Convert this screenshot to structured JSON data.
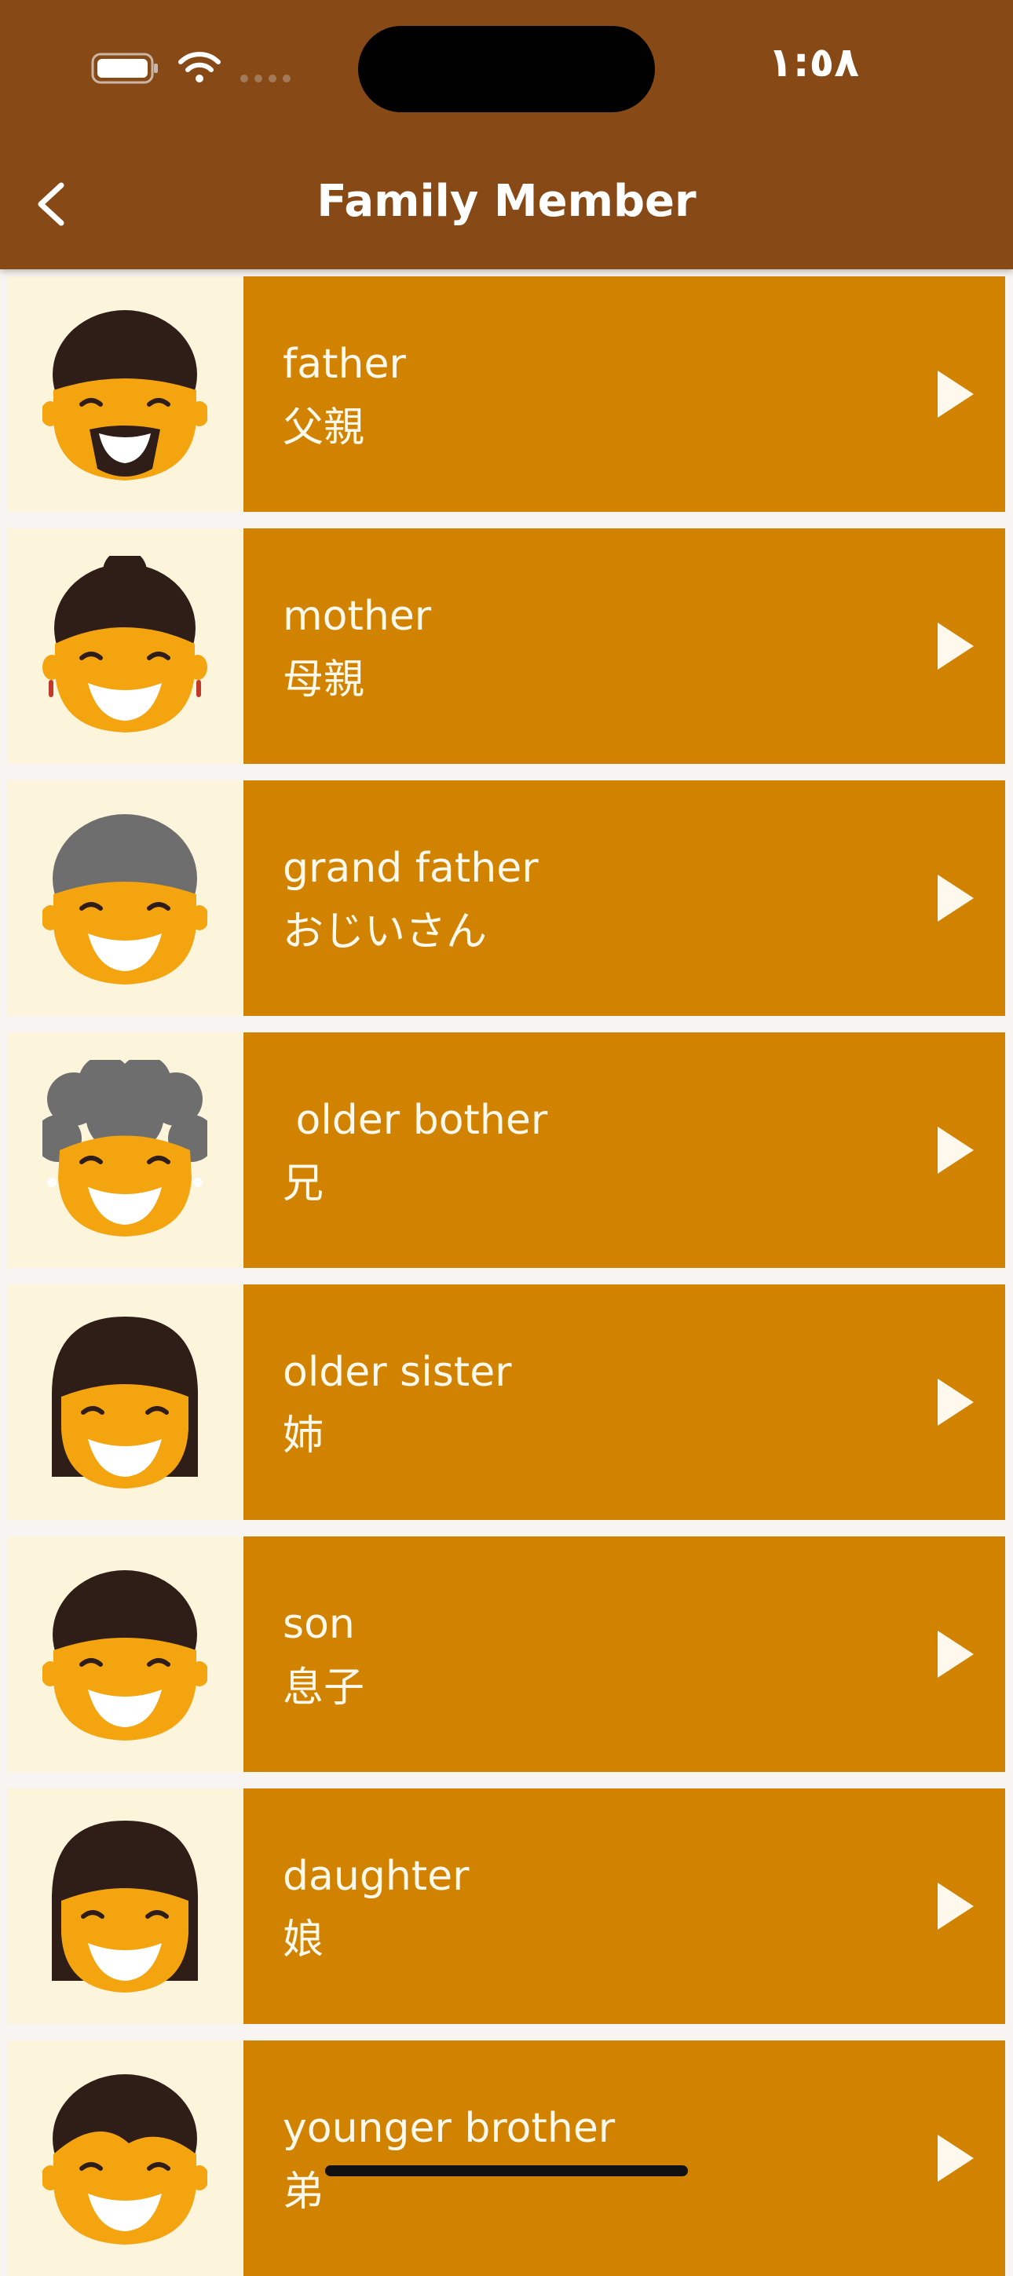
{
  "status_bar": {
    "time": "١:٥٨",
    "icons": [
      "battery-icon",
      "wifi-icon",
      "cellular-signal-icon"
    ]
  },
  "app_bar": {
    "title": "Family Member",
    "back_icon": "chevron-left-icon",
    "background": "#874a16"
  },
  "colors": {
    "row_label_bg": "#d18300",
    "row_avatar_bg": "#fdf4dc",
    "face": "#f4a40f",
    "hair_dark": "#2f1d17",
    "hair_grey": "#6e6e6e"
  },
  "members": [
    {
      "english": "father",
      "japanese": "父親",
      "avatar": "man-beard-avatar",
      "play_icon": "play-icon"
    },
    {
      "english": "mother",
      "japanese": "母親",
      "avatar": "woman-bun-earrings-avatar",
      "play_icon": "play-icon"
    },
    {
      "english": "grand father",
      "japanese": "おじいさん",
      "avatar": "grey-haired-man-avatar",
      "play_icon": "play-icon"
    },
    {
      "english": " older bother",
      "japanese": "兄",
      "avatar": "curly-grey-haired-woman-avatar",
      "play_icon": "play-icon"
    },
    {
      "english": "older sister",
      "japanese": "姉",
      "avatar": "long-haired-woman-avatar",
      "play_icon": "play-icon"
    },
    {
      "english": "son",
      "japanese": "息子",
      "avatar": "short-haired-man-avatar",
      "play_icon": "play-icon"
    },
    {
      "english": "daughter",
      "japanese": "娘",
      "avatar": "long-haired-girl-avatar",
      "play_icon": "play-icon"
    },
    {
      "english": "younger brother",
      "japanese": "弟",
      "avatar": "side-parted-boy-avatar",
      "play_icon": "play-icon"
    }
  ]
}
